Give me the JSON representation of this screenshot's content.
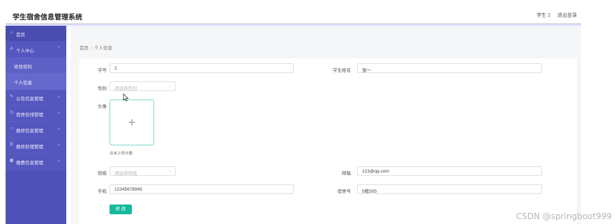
{
  "header": {
    "title": "学生宿舍信息管理系统",
    "user": "学生 2",
    "logout": "退出登录"
  },
  "sidebar": {
    "items": [
      {
        "label": "首页",
        "icon": "home-icon"
      },
      {
        "label": "个人中心",
        "icon": "user-icon",
        "expanded": true
      },
      {
        "label": "修改密码"
      },
      {
        "label": "个人信息"
      },
      {
        "label": "公告信息管理",
        "icon": "notice-icon"
      },
      {
        "label": "宿舍安排管理",
        "icon": "clock-icon"
      },
      {
        "label": "报修信息管理",
        "icon": "circle-icon"
      },
      {
        "label": "报修处理管理",
        "icon": "list-icon"
      },
      {
        "label": "缴费信息管理",
        "icon": "grid-icon"
      }
    ]
  },
  "breadcrumb": {
    "home": "首页",
    "separator": "/",
    "current": "个人信息"
  },
  "form": {
    "student_id_label": "学号",
    "student_id_value": "2",
    "student_name_label": "学生姓名",
    "student_name_value": "张一",
    "gender_label": "性别",
    "gender_placeholder": "请选择性别",
    "avatar_label": "头像",
    "avatar_tip": "点击上传头像",
    "class_label": "班级",
    "class_placeholder": "请选择班级",
    "email_label": "邮箱",
    "email_value": "123@qq.com",
    "phone_label": "手机",
    "phone_value": "12345678945",
    "dorm_label": "宿舍号",
    "dorm_value": "5栋505",
    "submit_label": "修 改"
  },
  "colors": {
    "sidebar": "#4f52b9",
    "accent": "#16b99c"
  },
  "watermark": "CSDN @springboot999"
}
